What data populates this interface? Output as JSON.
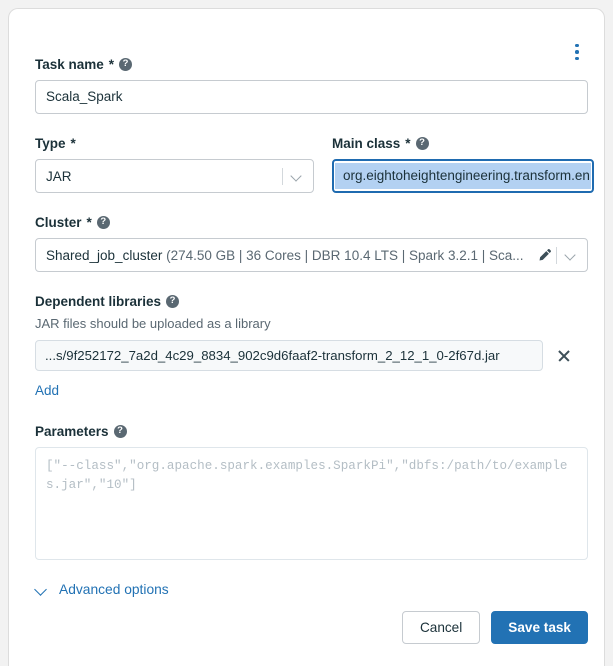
{
  "card": {
    "menu_icon": "kebab-menu-icon"
  },
  "fields": {
    "task_name": {
      "label": "Task name",
      "required_marker": "*",
      "help_glyph": "?",
      "value": "Scala_Spark"
    },
    "type": {
      "label": "Type",
      "required_marker": "*",
      "value": "JAR",
      "options": [
        "JAR"
      ]
    },
    "main_class": {
      "label": "Main class",
      "required_marker": "*",
      "help_glyph": "?",
      "value": "org.eightoheightengineering.transform.en"
    },
    "cluster": {
      "label": "Cluster",
      "required_marker": "*",
      "help_glyph": "?",
      "name": "Shared_job_cluster",
      "details": "(274.50 GB | 36 Cores | DBR 10.4 LTS | Spark 3.2.1 | Sca...",
      "edit_icon": "pencil-icon",
      "dropdown_icon": "chevron-down-icon"
    },
    "dependent_libraries": {
      "label": "Dependent libraries",
      "help_glyph": "?",
      "note": "JAR files should be uploaded as a library",
      "library_path": "...s/9f252172_7a2d_4c29_8834_902c9d6faaf2-transform_2_12_1_0-2f67d.jar",
      "remove_icon": "close-icon",
      "add_label": "Add"
    },
    "parameters": {
      "label": "Parameters",
      "help_glyph": "?",
      "value": "",
      "placeholder": "[\"--class\",\"org.apache.spark.examples.SparkPi\",\"dbfs:/path/to/examples.jar\",\"10\"]"
    }
  },
  "advanced": {
    "label": "Advanced options",
    "chevron_icon": "chevron-down-icon"
  },
  "footer": {
    "cancel_label": "Cancel",
    "save_label": "Save task"
  },
  "colors": {
    "accent": "#2272b4",
    "selection": "#b3d1f2",
    "focus_border": "#1f6bb0",
    "text": "#1b3139",
    "muted": "#5a6872"
  }
}
